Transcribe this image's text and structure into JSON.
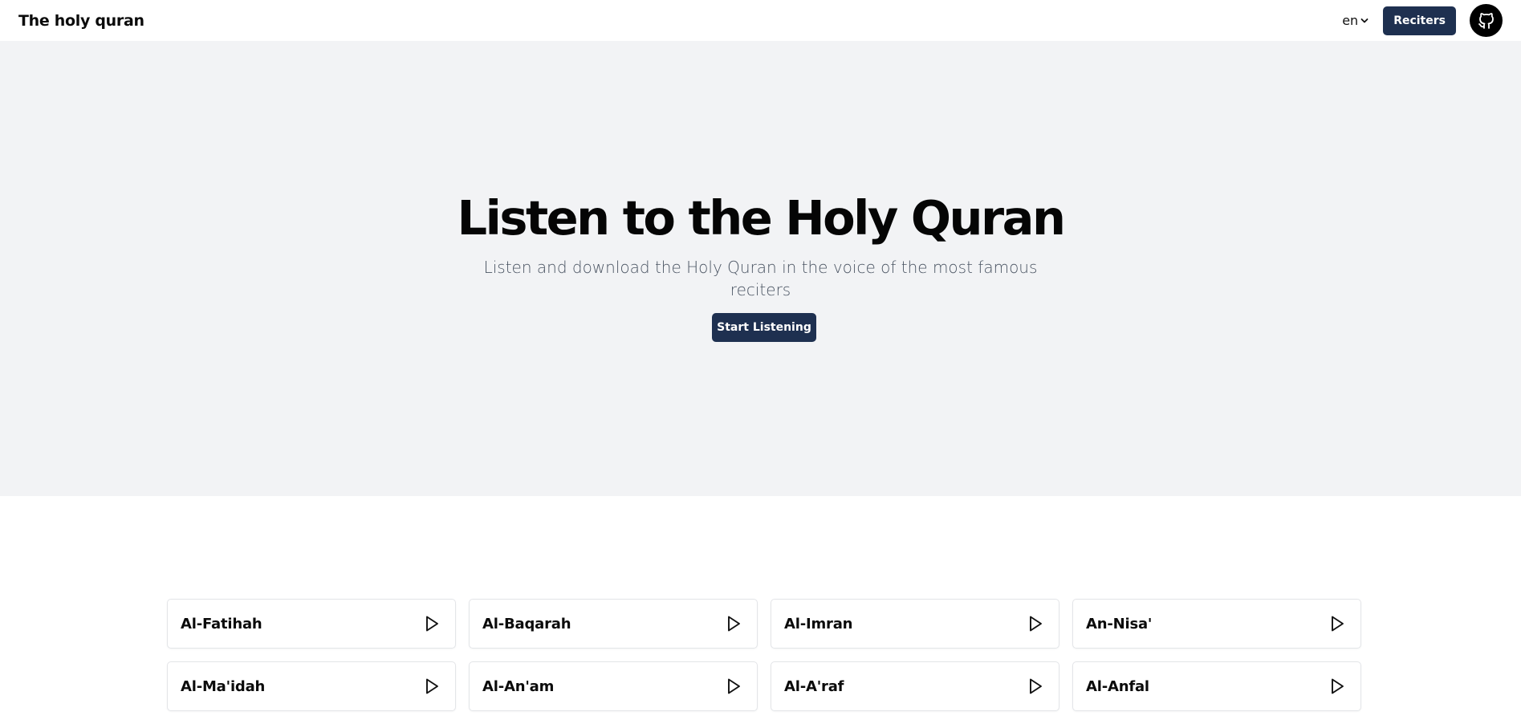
{
  "nav": {
    "brand": "The holy quran",
    "language": "en",
    "reciters_label": "Reciters",
    "github_icon": "github-icon",
    "language_icon": "chevron-down-icon"
  },
  "hero": {
    "title": "Listen to the Holy Quran",
    "subtitle": "Listen and download the Holy Quran in the voice of the most famous reciters",
    "cta_label": "Start Listening"
  },
  "surahs": [
    {
      "name": "Al-Fatihah"
    },
    {
      "name": "Al-Baqarah"
    },
    {
      "name": "Al-Imran"
    },
    {
      "name": "An-Nisa'"
    },
    {
      "name": "Al-Ma'idah"
    },
    {
      "name": "Al-An'am"
    },
    {
      "name": "Al-A'raf"
    },
    {
      "name": "Al-Anfal"
    }
  ],
  "colors": {
    "accent": "#1e3050",
    "hero_background": "#f2f3f5",
    "subtitle_text": "#4b5563"
  }
}
